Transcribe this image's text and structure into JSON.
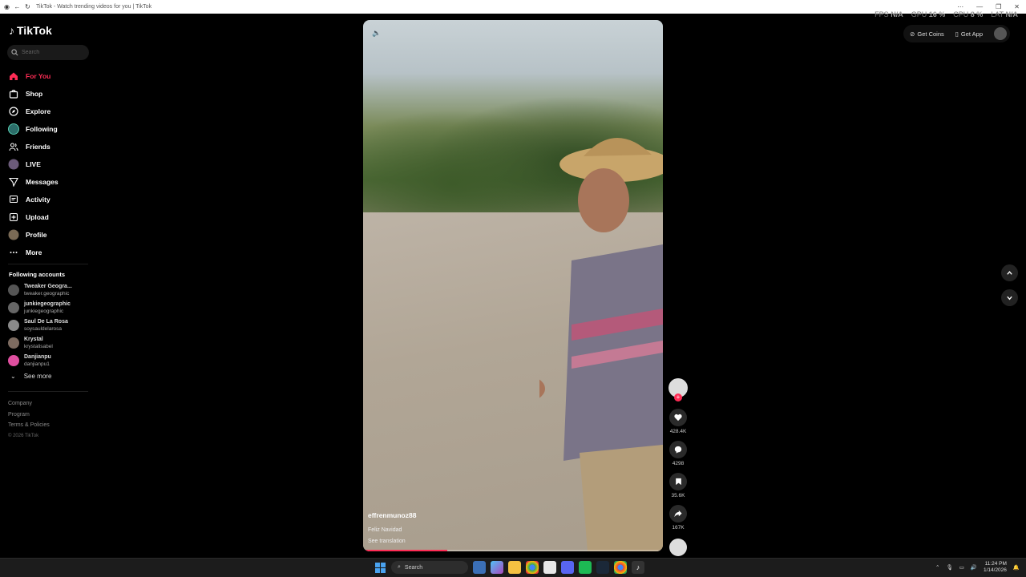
{
  "browser": {
    "tab_title": "TikTok - Watch trending videos for you | TikTok"
  },
  "stats": {
    "fps_label": "FPS",
    "fps_value": "N/A",
    "gpu_label": "GPU",
    "gpu_value": "16 %",
    "cpu_label": "CPU",
    "cpu_value": "8 %",
    "lat_label": "LAT",
    "lat_value": "N/A"
  },
  "sidebar": {
    "logo_text": "TikTok",
    "search_placeholder": "Search",
    "nav": [
      {
        "label": "For You",
        "icon": "home-icon"
      },
      {
        "label": "Shop",
        "icon": "shop-icon"
      },
      {
        "label": "Explore",
        "icon": "compass-icon"
      },
      {
        "label": "Following",
        "icon": "following-avatar-icon"
      },
      {
        "label": "Friends",
        "icon": "friends-icon"
      },
      {
        "label": "LIVE",
        "icon": "live-avatar-icon"
      },
      {
        "label": "Messages",
        "icon": "messages-icon"
      },
      {
        "label": "Activity",
        "icon": "activity-icon"
      },
      {
        "label": "Upload",
        "icon": "upload-icon"
      },
      {
        "label": "Profile",
        "icon": "profile-avatar-icon"
      },
      {
        "label": "More",
        "icon": "more-icon"
      }
    ],
    "following_title": "Following accounts",
    "accounts": [
      {
        "name": "Tweaker Geogra...",
        "handle": "tweaker.geographic"
      },
      {
        "name": "junkiegeographic",
        "handle": "junkiegeographic"
      },
      {
        "name": "Saul De La Rosa",
        "handle": "soysauldelarosa"
      },
      {
        "name": "Krystal",
        "handle": "krystalisabel"
      },
      {
        "name": "Danjianpu",
        "handle": "danjianpu1"
      }
    ],
    "see_more": "See more",
    "footer": {
      "company": "Company",
      "program": "Program",
      "terms": "Terms & Policies",
      "copyright": "© 2026 TikTok"
    }
  },
  "topbar": {
    "get_coins": "Get Coins",
    "get_app": "Get App"
  },
  "video": {
    "author": "effrenmunoz88",
    "description": "Feliz Navidad",
    "see_translation": "See translation",
    "progress": 0.28
  },
  "actions": {
    "likes": "428.4K",
    "comments": "4298",
    "saves": "35.6K",
    "shares": "167K"
  },
  "taskbar": {
    "search_label": "Search",
    "time": "11:24 PM",
    "date": "1/14/2026"
  }
}
